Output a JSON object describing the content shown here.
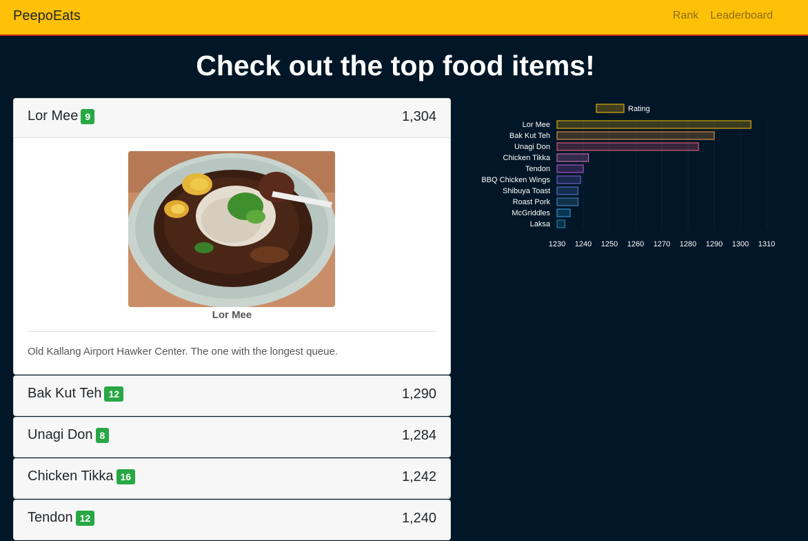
{
  "navbar": {
    "brand": "PeepoEats",
    "links": [
      "Rank",
      "Leaderboard"
    ]
  },
  "page": {
    "title": "Check out the top food items!"
  },
  "items": [
    {
      "name": "Lor Mee",
      "badge": "9",
      "rating": "1,304"
    },
    {
      "name": "Bak Kut Teh",
      "badge": "12",
      "rating": "1,290"
    },
    {
      "name": "Unagi Don",
      "badge": "8",
      "rating": "1,284"
    },
    {
      "name": "Chicken Tikka",
      "badge": "16",
      "rating": "1,242"
    },
    {
      "name": "Tendon",
      "badge": "12",
      "rating": "1,240"
    }
  ],
  "expanded": {
    "caption": "Lor Mee",
    "description": "Old Kallang Airport Hawker Center. The one with the longest queue."
  },
  "chart_data": {
    "type": "bar",
    "orientation": "horizontal",
    "categories": [
      "Lor Mee",
      "Bak Kut Teh",
      "Unagi Don",
      "Chicken Tikka",
      "Tendon",
      "BBQ Chicken Wings",
      "Shibuya Toast",
      "Roast Pork",
      "McGriddles",
      "Laksa"
    ],
    "series": [
      {
        "name": "Rating",
        "values": [
          1304,
          1290,
          1284,
          1242,
          1240,
          1239,
          1238,
          1238,
          1235,
          1233
        ]
      }
    ],
    "xlim": [
      1230,
      1310
    ],
    "xticks": [
      1230,
      1240,
      1250,
      1260,
      1270,
      1280,
      1290,
      1300,
      1310
    ],
    "legend": "top",
    "colors": [
      "#ffc107",
      "#ff9f40",
      "#ff6384",
      "#e377c2",
      "#c05bd9",
      "#7b6bd9",
      "#5b7fd9",
      "#4a90c8",
      "#36a2eb",
      "#2a8fb8"
    ]
  }
}
